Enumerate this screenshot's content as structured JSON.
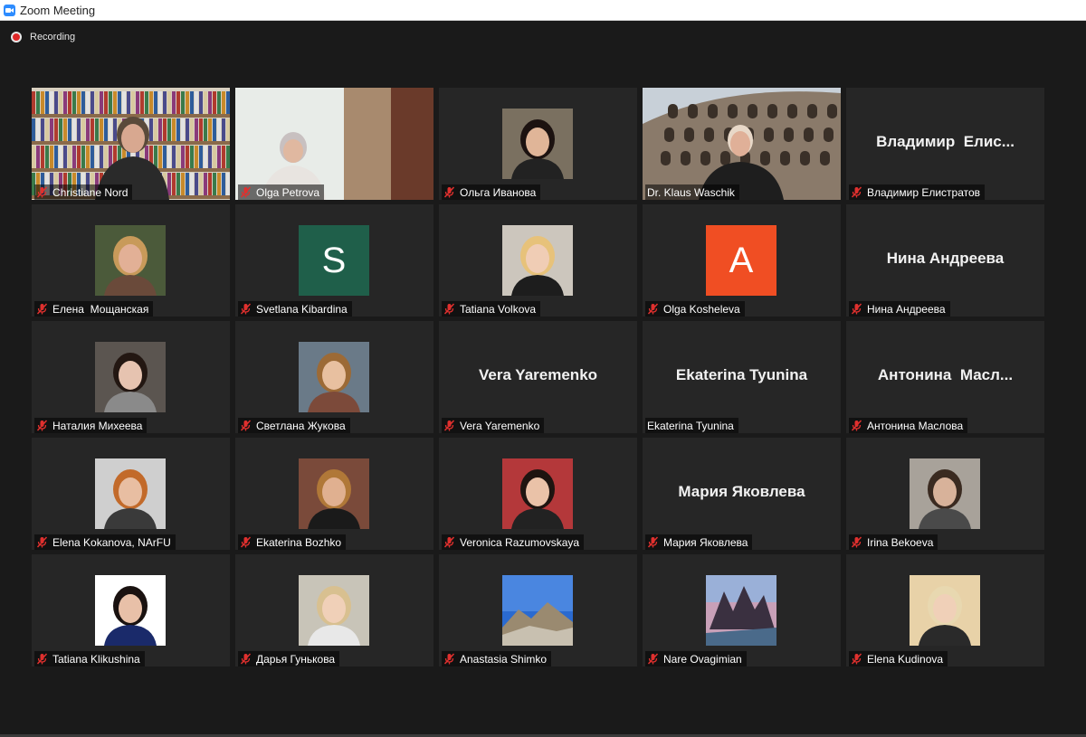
{
  "window": {
    "title": "Zoom Meeting"
  },
  "recording": {
    "label": "Recording"
  },
  "colors": {
    "active_speaker": "#c8e66a",
    "muted_icon": "#e0302e",
    "tile_bg": "#262626"
  },
  "participants": [
    {
      "name": "Christiane Nord",
      "muted": true,
      "type": "video",
      "scene": "bookshelf"
    },
    {
      "name": "Olga Petrova",
      "muted": true,
      "type": "video",
      "scene": "room"
    },
    {
      "name": "Ольга Иванова",
      "muted": true,
      "type": "photo",
      "bg": "#7a7060",
      "skin": "#e0b598",
      "hair": "#1c1210",
      "cloth": "#222"
    },
    {
      "name": "Dr. Klaus Waschik",
      "muted": false,
      "type": "video",
      "scene": "colosseum",
      "active": true
    },
    {
      "name": "Владимир Елистратов",
      "display": "Владимир  Елис...",
      "muted": true,
      "type": "name"
    },
    {
      "name": "Елена  Мощанская",
      "muted": true,
      "type": "photo",
      "bg": "#4b5a3a",
      "skin": "#e2b096",
      "hair": "#c89a5a",
      "cloth": "#6a4a3a"
    },
    {
      "name": "Svetlana Kibardina",
      "muted": true,
      "type": "letter",
      "letter": "S",
      "color": "#1f5f4a"
    },
    {
      "name": "Tatiana Volkova",
      "muted": true,
      "type": "photo",
      "bg": "#ccc6bd",
      "skin": "#f0cdb5",
      "hair": "#e7c27a",
      "cloth": "#1d1d1d"
    },
    {
      "name": "Olga Kosheleva",
      "muted": true,
      "type": "letter",
      "letter": "A",
      "color": "#f04e23"
    },
    {
      "name": "Нина Андреева",
      "display": "Нина Андреева",
      "muted": true,
      "type": "name"
    },
    {
      "name": "Наталия Михеева",
      "muted": true,
      "type": "photo",
      "bg": "#5b5550",
      "skin": "#e6c3b0",
      "hair": "#231712",
      "cloth": "#8a8a8a"
    },
    {
      "name": "Светлана Жукова",
      "muted": true,
      "type": "photo",
      "bg": "#6a7a88",
      "skin": "#e8c0a0",
      "hair": "#9c6a36",
      "cloth": "#7c4a3a"
    },
    {
      "name": "Vera Yaremenko",
      "display": "Vera Yaremenko",
      "muted": true,
      "type": "name"
    },
    {
      "name": "Ekaterina Tyunina",
      "display": "Ekaterina Tyunina",
      "muted": false,
      "type": "name"
    },
    {
      "name": "Антонина Маслова",
      "display": "Антонина  Масл...",
      "muted": true,
      "type": "name"
    },
    {
      "name": "Elena Kokanova, NArFU",
      "muted": true,
      "type": "photo",
      "bg": "#cfcfcf",
      "skin": "#e8bea2",
      "hair": "#c26a2a",
      "cloth": "#3a3a3a"
    },
    {
      "name": "Ekaterina Bozhko",
      "muted": true,
      "type": "photo",
      "bg": "#7a4a3a",
      "skin": "#e0b090",
      "hair": "#b07838",
      "cloth": "#1a1a1a"
    },
    {
      "name": "Veronica Razumovskaya",
      "muted": true,
      "type": "photo",
      "bg": "#b4383a",
      "skin": "#eac2a8",
      "hair": "#1e1410",
      "cloth": "#222"
    },
    {
      "name": "Мария Яковлева",
      "display": "Мария Яковлева",
      "muted": true,
      "type": "name"
    },
    {
      "name": "Irina Bekoeva",
      "muted": true,
      "type": "photo",
      "bg": "#a8a29a",
      "skin": "#d8b29a",
      "hair": "#3a2a20",
      "cloth": "#4a4a4a"
    },
    {
      "name": "Tatiana Klikushina",
      "muted": true,
      "type": "photo",
      "bg": "#ffffff",
      "skin": "#e8c0a8",
      "hair": "#1a1210",
      "cloth": "#1a2a6a"
    },
    {
      "name": "Дарья Гунькова",
      "muted": true,
      "type": "photo",
      "bg": "#c8c4b8",
      "skin": "#f0d0b8",
      "hair": "#d8c090",
      "cloth": "#e8e8e8"
    },
    {
      "name": "Anastasia Shimko",
      "muted": true,
      "type": "landscape",
      "scene": "mountain-sky"
    },
    {
      "name": "Nare Ovagimian",
      "muted": true,
      "type": "landscape",
      "scene": "mountain-pink"
    },
    {
      "name": "Elena Kudinova",
      "muted": true,
      "type": "photo",
      "bg": "#e8d2a8",
      "skin": "#f0d0b8",
      "hair": "#e8d8b0",
      "cloth": "#2a2a2a"
    }
  ]
}
